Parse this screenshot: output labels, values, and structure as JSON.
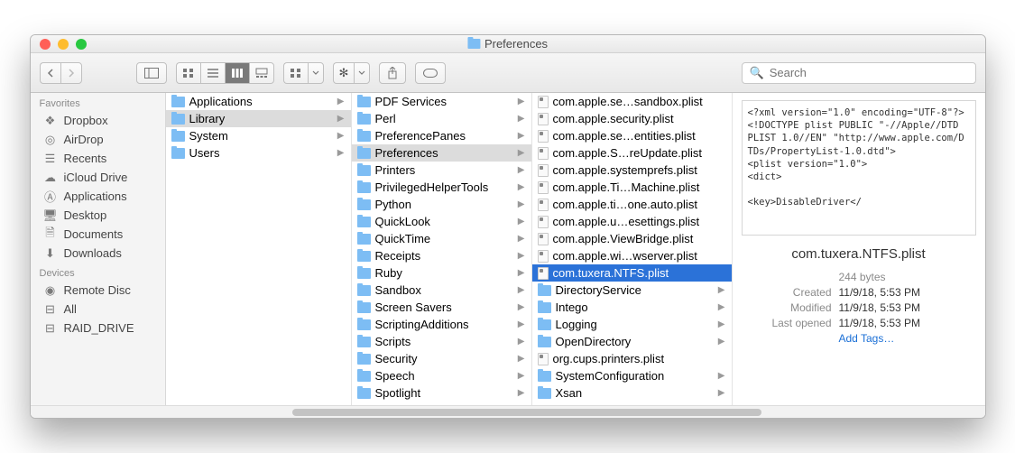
{
  "window": {
    "title": "Preferences"
  },
  "search": {
    "placeholder": "Search"
  },
  "sidebar": {
    "sections": [
      {
        "title": "Favorites",
        "items": [
          {
            "label": "Dropbox",
            "icon": "dropbox"
          },
          {
            "label": "AirDrop",
            "icon": "airdrop"
          },
          {
            "label": "Recents",
            "icon": "recents"
          },
          {
            "label": "iCloud Drive",
            "icon": "cloud"
          },
          {
            "label": "Applications",
            "icon": "apps"
          },
          {
            "label": "Desktop",
            "icon": "desktop"
          },
          {
            "label": "Documents",
            "icon": "docs"
          },
          {
            "label": "Downloads",
            "icon": "downloads"
          }
        ]
      },
      {
        "title": "Devices",
        "items": [
          {
            "label": "Remote Disc",
            "icon": "disc"
          },
          {
            "label": "All",
            "icon": "drive"
          },
          {
            "label": "RAID_DRIVE",
            "icon": "drive"
          }
        ]
      }
    ]
  },
  "columns": {
    "c1": [
      {
        "name": "Applications",
        "type": "folder",
        "arrow": true
      },
      {
        "name": "Library",
        "type": "folder",
        "arrow": true,
        "sel": "grey"
      },
      {
        "name": "System",
        "type": "folder",
        "arrow": true
      },
      {
        "name": "Users",
        "type": "folder",
        "arrow": true
      }
    ],
    "c2": [
      {
        "name": "PDF Services",
        "type": "folder",
        "arrow": true
      },
      {
        "name": "Perl",
        "type": "folder",
        "arrow": true
      },
      {
        "name": "PreferencePanes",
        "type": "folder",
        "arrow": true
      },
      {
        "name": "Preferences",
        "type": "folder",
        "arrow": true,
        "sel": "grey"
      },
      {
        "name": "Printers",
        "type": "folder",
        "arrow": true
      },
      {
        "name": "PrivilegedHelperTools",
        "type": "folder",
        "arrow": true
      },
      {
        "name": "Python",
        "type": "folder",
        "arrow": true
      },
      {
        "name": "QuickLook",
        "type": "folder",
        "arrow": true
      },
      {
        "name": "QuickTime",
        "type": "folder",
        "arrow": true
      },
      {
        "name": "Receipts",
        "type": "folder",
        "arrow": true
      },
      {
        "name": "Ruby",
        "type": "folder",
        "arrow": true
      },
      {
        "name": "Sandbox",
        "type": "folder",
        "arrow": true
      },
      {
        "name": "Screen Savers",
        "type": "folder",
        "arrow": true
      },
      {
        "name": "ScriptingAdditions",
        "type": "folder",
        "arrow": true
      },
      {
        "name": "Scripts",
        "type": "folder",
        "arrow": true
      },
      {
        "name": "Security",
        "type": "folder",
        "arrow": true
      },
      {
        "name": "Speech",
        "type": "folder",
        "arrow": true
      },
      {
        "name": "Spotlight",
        "type": "folder",
        "arrow": true
      }
    ],
    "c3": [
      {
        "name": "com.apple.se…sandbox.plist",
        "type": "plist"
      },
      {
        "name": "com.apple.security.plist",
        "type": "plist"
      },
      {
        "name": "com.apple.se…entities.plist",
        "type": "plist"
      },
      {
        "name": "com.apple.S…reUpdate.plist",
        "type": "plist"
      },
      {
        "name": "com.apple.systemprefs.plist",
        "type": "plist"
      },
      {
        "name": "com.apple.Ti…Machine.plist",
        "type": "plist"
      },
      {
        "name": "com.apple.ti…one.auto.plist",
        "type": "plist"
      },
      {
        "name": "com.apple.u…esettings.plist",
        "type": "plist"
      },
      {
        "name": "com.apple.ViewBridge.plist",
        "type": "plist"
      },
      {
        "name": "com.apple.wi…wserver.plist",
        "type": "plist"
      },
      {
        "name": "com.tuxera.NTFS.plist",
        "type": "plist",
        "sel": "blue"
      },
      {
        "name": "DirectoryService",
        "type": "folder",
        "arrow": true
      },
      {
        "name": "Intego",
        "type": "folder",
        "arrow": true
      },
      {
        "name": "Logging",
        "type": "folder",
        "arrow": true
      },
      {
        "name": "OpenDirectory",
        "type": "folder",
        "arrow": true
      },
      {
        "name": "org.cups.printers.plist",
        "type": "plist"
      },
      {
        "name": "SystemConfiguration",
        "type": "folder",
        "arrow": true
      },
      {
        "name": "Xsan",
        "type": "folder",
        "arrow": true
      }
    ]
  },
  "preview": {
    "xml": "<?xml version=\"1.0\" encoding=\"UTF-8\"?>\n<!DOCTYPE plist PUBLIC \"-//Apple//DTD PLIST 1.0//EN\" \"http://www.apple.com/DTDs/PropertyList-1.0.dtd\">\n<plist version=\"1.0\">\n<dict>\n\n<key>DisableDriver</",
    "filename": "com.tuxera.NTFS.plist",
    "size": "244 bytes",
    "created_label": "Created",
    "created": "11/9/18, 5:53 PM",
    "modified_label": "Modified",
    "modified": "11/9/18, 5:53 PM",
    "opened_label": "Last opened",
    "opened": "11/9/18, 5:53 PM",
    "add_tags": "Add Tags…"
  }
}
